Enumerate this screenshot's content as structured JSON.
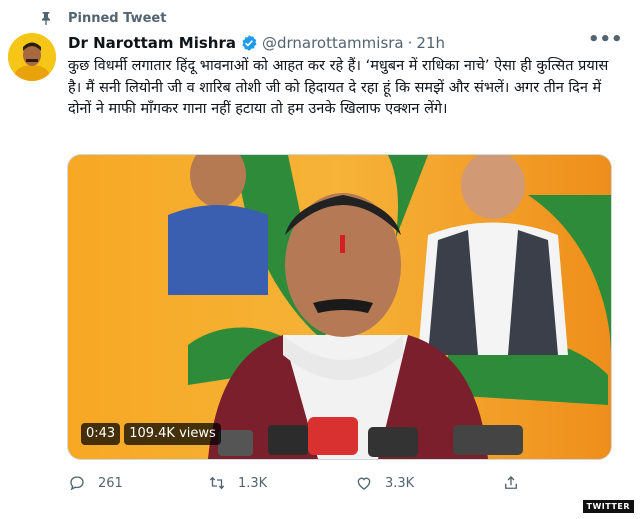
{
  "pinned": {
    "label": "Pinned Tweet",
    "icon": "pin-icon"
  },
  "author": {
    "name": "Dr Narottam Mishra",
    "verified_icon": "verified-badge-icon",
    "handle": "@drnarottammisra",
    "separator": "·",
    "time": "21h"
  },
  "more_label": "•••",
  "tweet": {
    "text": "कुछ विधर्मी लगातार हिंदू भावनाओं को आहत कर रहे हैं। ‘मधुबन में राधिका नाचे’ ऐसा ही कुत्सित प्रयास है। मैं सनी लियोनी जी व शारिब तोशी जी को हिदायत दे रहा हूं कि समझें और संभलें। अगर तीन दिन में दोनों ने माफी माँगकर गाना नहीं हटाया तो हम उनके खिलाफ एक्शन लेंगे।"
  },
  "video": {
    "duration": "0:43",
    "views": "109.4K views"
  },
  "actions": {
    "replies": "261",
    "retweets": "1.3K",
    "likes": "3.3K"
  },
  "watermark": "TWITTER",
  "colors": {
    "accent": "#1d9bf0",
    "muted": "#536471",
    "saffron": "#f4a21b"
  }
}
